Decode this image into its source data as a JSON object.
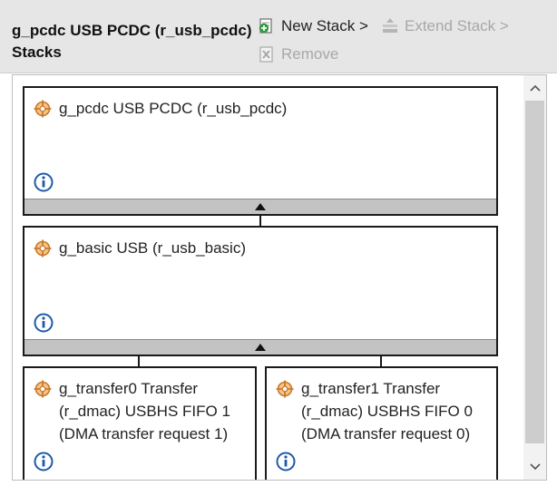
{
  "header": {
    "title_line1": "g_pcdc USB PCDC (r_usb_pcdc)",
    "title_line2": "Stacks"
  },
  "toolbar": {
    "new_stack": "New Stack >",
    "extend_stack": "Extend Stack >",
    "remove": "Remove"
  },
  "stack": {
    "top": {
      "title": "g_pcdc USB PCDC (r_usb_pcdc)"
    },
    "middle": {
      "title": "g_basic USB (r_usb_basic)"
    },
    "bottom_left": {
      "line1": "g_transfer0 Transfer",
      "line2": "(r_dmac) USBHS FIFO 1",
      "line3": "(DMA transfer request 1)"
    },
    "bottom_right": {
      "line1": "g_transfer1 Transfer",
      "line2": "(r_dmac) USBHS FIFO 0",
      "line3": "(DMA transfer request 0)"
    }
  },
  "icons": {
    "module": "gear-icon",
    "info": "info-icon",
    "new_stack": "add-stack-icon",
    "extend_stack": "extend-stack-icon",
    "remove": "remove-icon"
  },
  "colors": {
    "header_bg": "#e6e6e6",
    "card_border": "#1a1a1a",
    "bar": "#c3c3c3",
    "info_blue": "#1e5aa8",
    "module_orange": "#c8782a"
  }
}
